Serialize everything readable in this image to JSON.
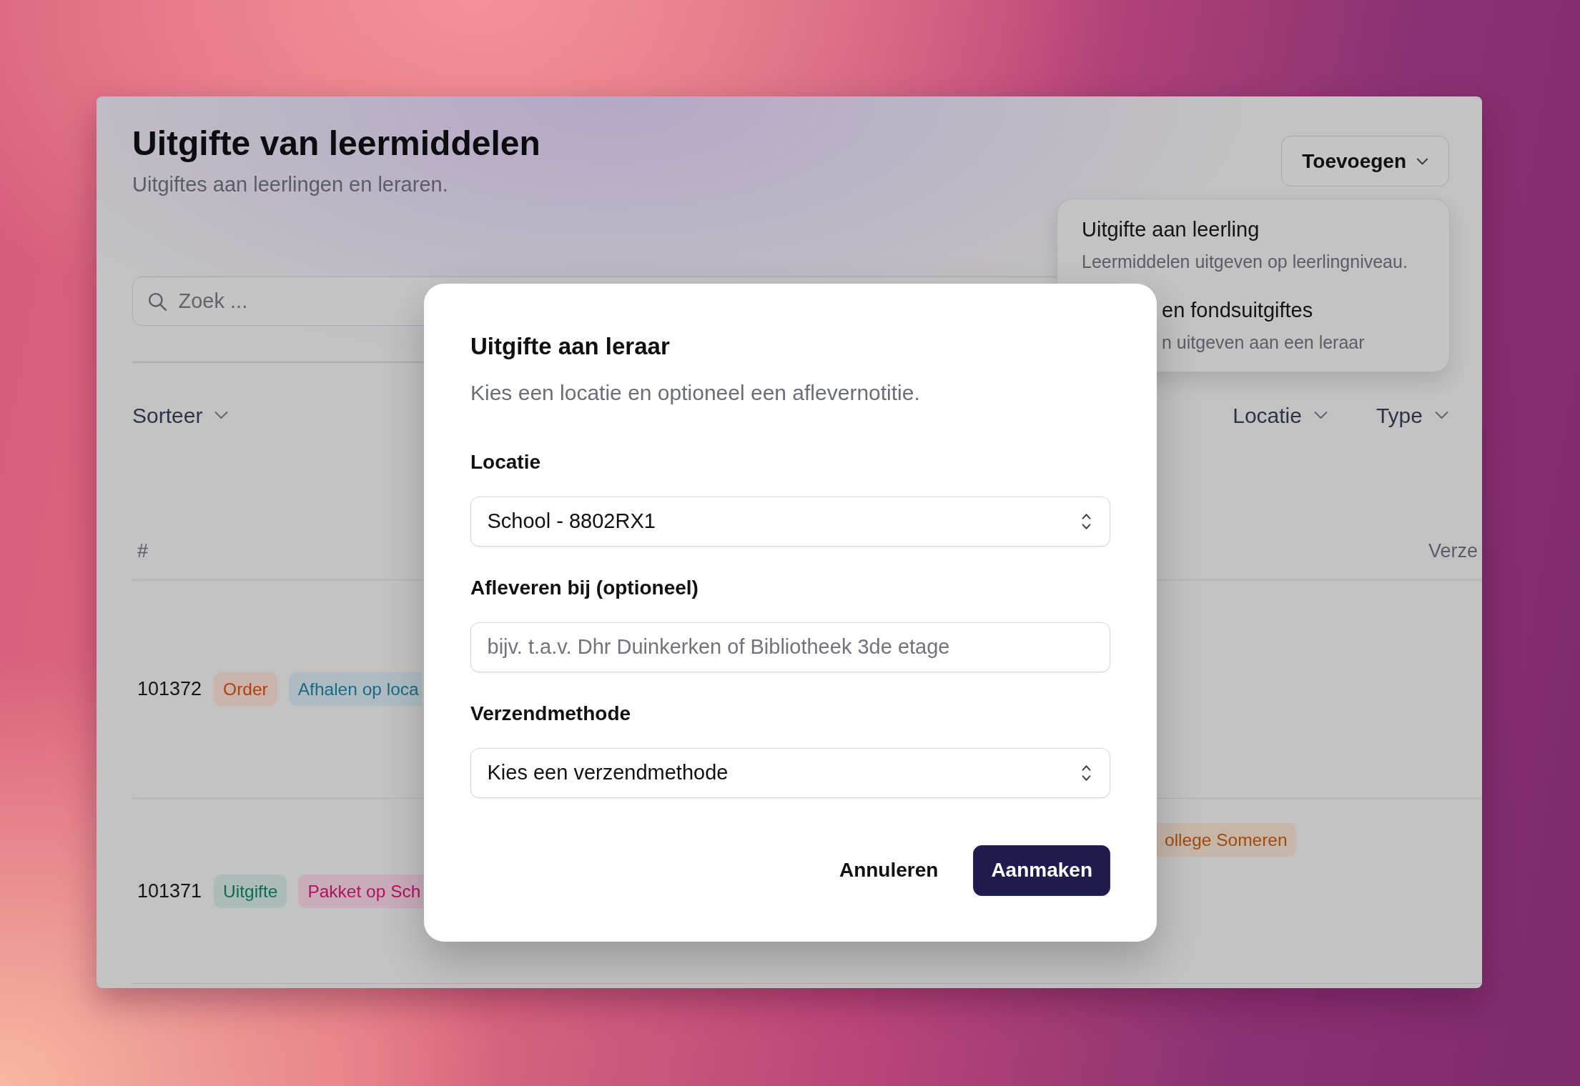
{
  "page": {
    "title": "Uitgifte van leermiddelen",
    "subtitle": "Uitgiftes aan leerlingen en leraren."
  },
  "add_button": {
    "label": "Toevoegen"
  },
  "add_menu": {
    "items": [
      {
        "title": "Uitgifte aan leerling",
        "description": "Leermiddelen uitgeven op leerlingniveau."
      },
      {
        "title": "en fondsuitgiftes",
        "description": "n uitgeven aan een leraar"
      }
    ]
  },
  "search": {
    "placeholder": "Zoek ..."
  },
  "sort": {
    "label": "Sorteer"
  },
  "filters": [
    {
      "label": "Locatie"
    },
    {
      "label": "Type"
    }
  ],
  "table": {
    "columns": [
      {
        "label": "#"
      },
      {
        "label": "Verze"
      }
    ],
    "rows": [
      {
        "id": "101372",
        "tags": [
          {
            "label": "Order",
            "color": "#b23f10"
          },
          {
            "label": "Afhalen op loca",
            "color": "#1b6a83"
          }
        ]
      },
      {
        "id": "101371",
        "tags": [
          {
            "label": "Uitgifte",
            "color": "#0d6a55"
          },
          {
            "label": "Pakket op Sch",
            "color": "#b0125d"
          }
        ],
        "location_tag": {
          "label": "ollege Someren",
          "color": "#a24a08"
        }
      }
    ]
  },
  "dialog": {
    "title": "Uitgifte aan leraar",
    "description": "Kies een locatie en optioneel een aflevernotitie.",
    "fields": [
      {
        "kind": "select",
        "label": "Locatie",
        "value": "School - 8802RX1"
      },
      {
        "kind": "text",
        "label": "Afleveren bij (optioneel)",
        "placeholder": "bijv. t.a.v. Dhr Duinkerken of Bibliotheek 3de etage"
      },
      {
        "kind": "select",
        "label": "Verzendmethode",
        "value": "Kies een verzendmethode"
      }
    ],
    "buttons": [
      {
        "kind": "secondary",
        "label": "Annuleren"
      },
      {
        "kind": "primary",
        "label": "Aanmaken"
      }
    ]
  }
}
